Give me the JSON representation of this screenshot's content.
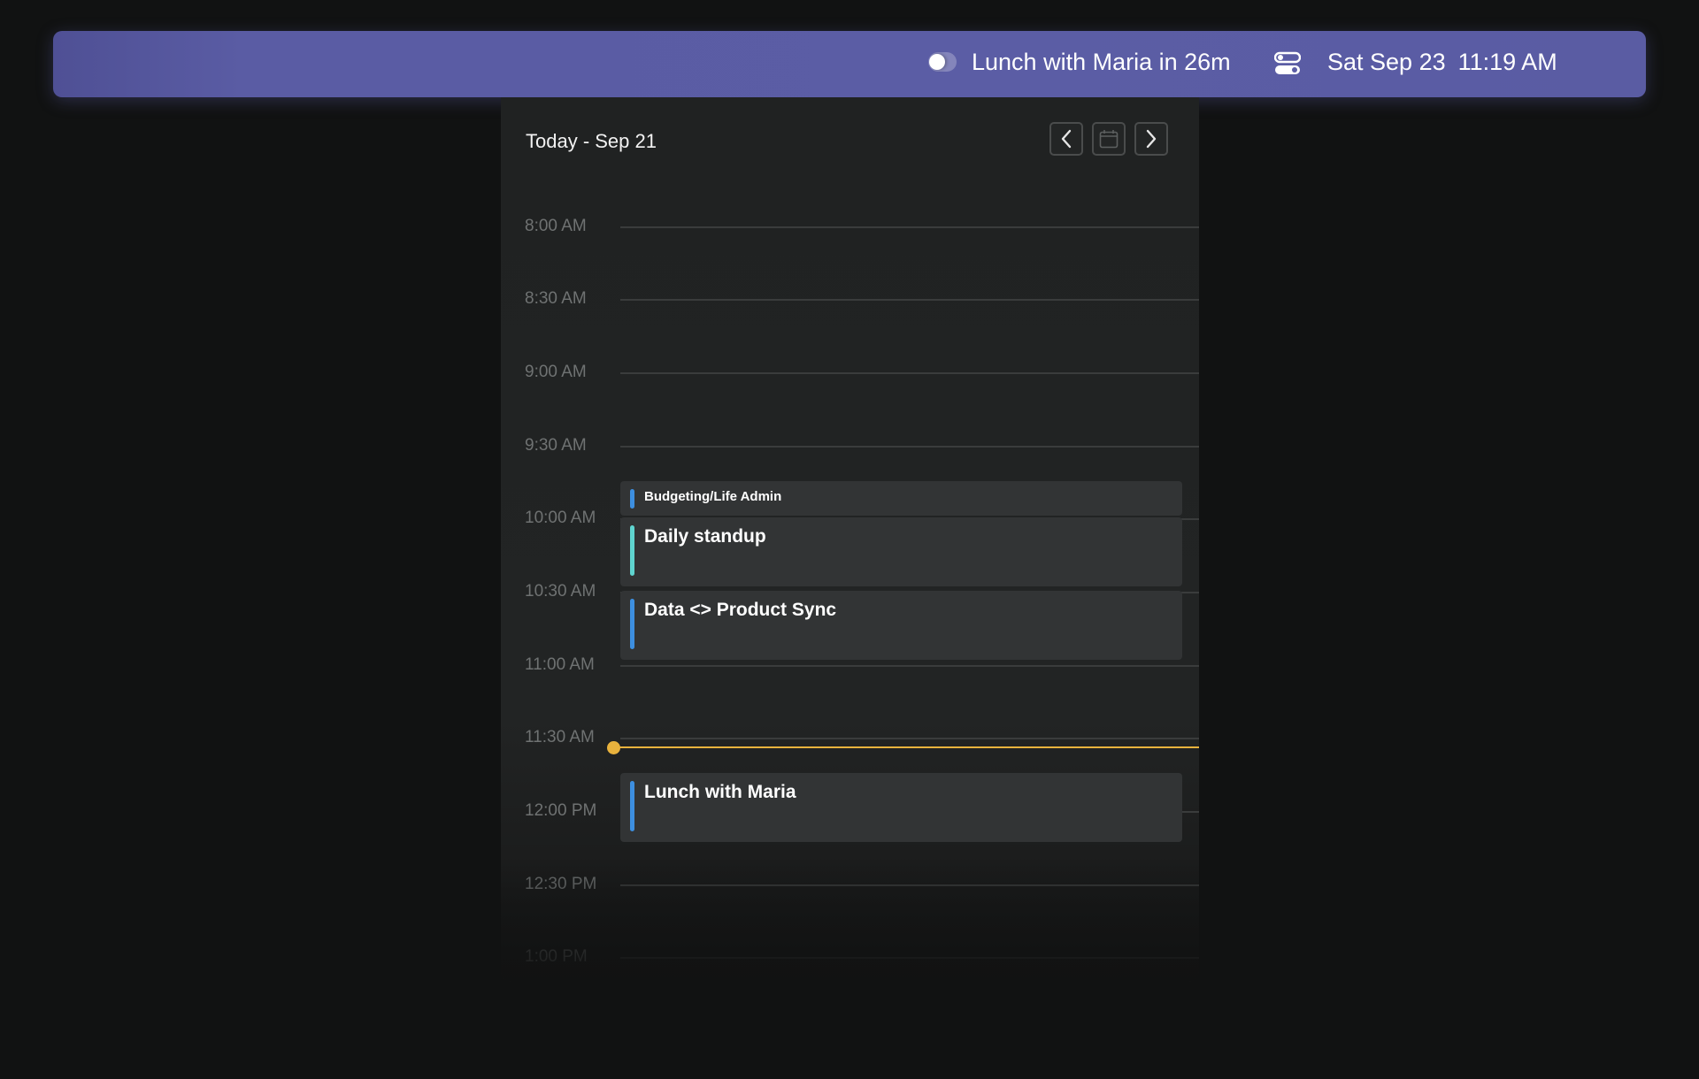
{
  "menubar": {
    "next_event_text": "Lunch with Maria in 26m",
    "date": "Sat Sep 23",
    "time": "11:19 AM",
    "icons": [
      "toggle-icon",
      "control-center-icon"
    ]
  },
  "calendar": {
    "title": "Today - Sep 21",
    "nav": {
      "prev_icon": "chevron-left-icon",
      "today_icon": "calendar-icon",
      "next_icon": "chevron-right-icon"
    },
    "time_labels": [
      "8:00 AM",
      "8:30 AM",
      "9:00 AM",
      "9:30 AM",
      "10:00 AM",
      "10:30 AM",
      "11:00 AM",
      "11:30 AM",
      "12:00 PM",
      "12:30 PM",
      "1:00 PM"
    ],
    "events": [
      {
        "title": "Budgeting/Life Admin",
        "color": "#3d8fe0"
      },
      {
        "title": "Daily standup",
        "color": "#5fd4cf"
      },
      {
        "title": "Data <> Product Sync",
        "color": "#3d8fe0"
      },
      {
        "title": "Lunch with Maria",
        "color": "#3d8fe0"
      }
    ],
    "now_indicator_color": "#e8b23d"
  },
  "colors": {
    "menubar_accent": "#5b5da5",
    "background": "#111212",
    "panel": "#222424"
  }
}
